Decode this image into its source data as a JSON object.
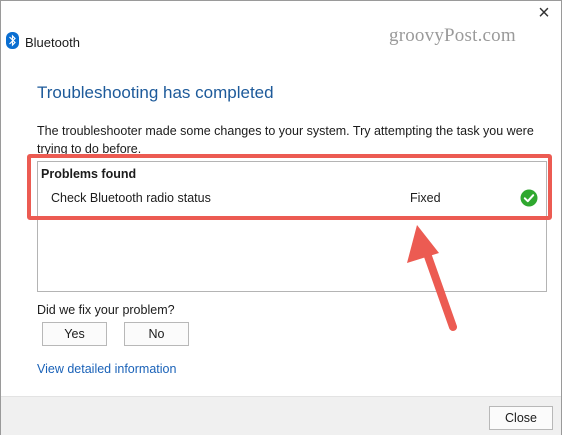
{
  "window": {
    "title": "Bluetooth",
    "close_glyph": "×",
    "watermark": "groovyPost.com"
  },
  "content": {
    "heading": "Troubleshooting has completed",
    "description": "The troubleshooter made some changes to your system. Try attempting the task you were trying to do before.",
    "problems_header": "Problems found",
    "problems": [
      {
        "name": "Check Bluetooth radio status",
        "status": "Fixed",
        "status_icon": "check-circle-icon"
      }
    ],
    "question": "Did we fix your problem?",
    "yes_label": "Yes",
    "no_label": "No",
    "details_link": "View detailed information"
  },
  "footer": {
    "close_label": "Close"
  },
  "colors": {
    "heading": "#1d5a9a",
    "link": "#1a62b8",
    "highlight": "#ec5b52",
    "check": "#2fa82f",
    "bluetooth": "#0a6ed1"
  }
}
